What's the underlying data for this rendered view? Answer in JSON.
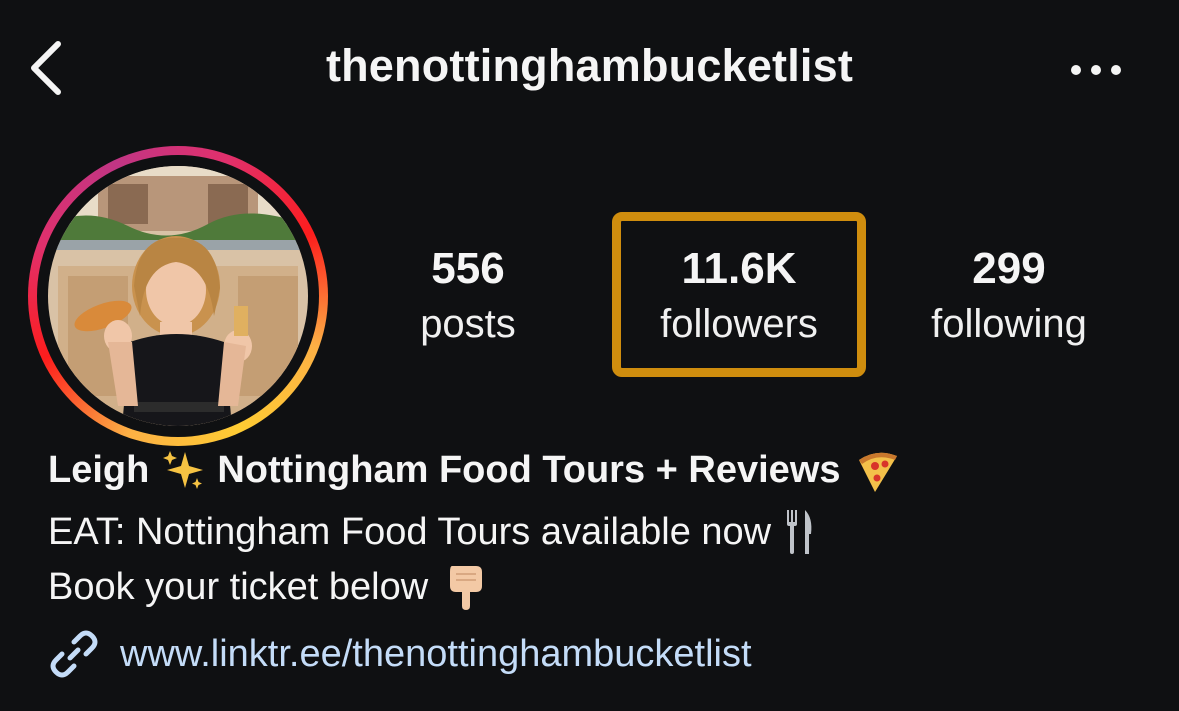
{
  "header": {
    "username": "thenottinghambucketlist"
  },
  "stats": {
    "posts": {
      "count": "556",
      "label": "posts"
    },
    "followers": {
      "count": "11.6K",
      "label": "followers"
    },
    "following": {
      "count": "299",
      "label": "following"
    }
  },
  "bio": {
    "name_part1": "Leigh",
    "name_part2": "Nottingham Food Tours + Reviews",
    "line1": "EAT: Nottingham Food Tours available now",
    "line2": "Book your ticket below"
  },
  "link": {
    "url_text": "www.linktr.ee/thenottinghambucketlist"
  },
  "colors": {
    "background": "#0f1012",
    "highlight": "#cf8d0e",
    "link": "#c4dcf8"
  },
  "icons": [
    "chevron-left-icon",
    "more-horizontal-icon",
    "sparkles-icon",
    "pizza-icon",
    "fork-knife-icon",
    "pointing-down-icon",
    "link-icon"
  ]
}
